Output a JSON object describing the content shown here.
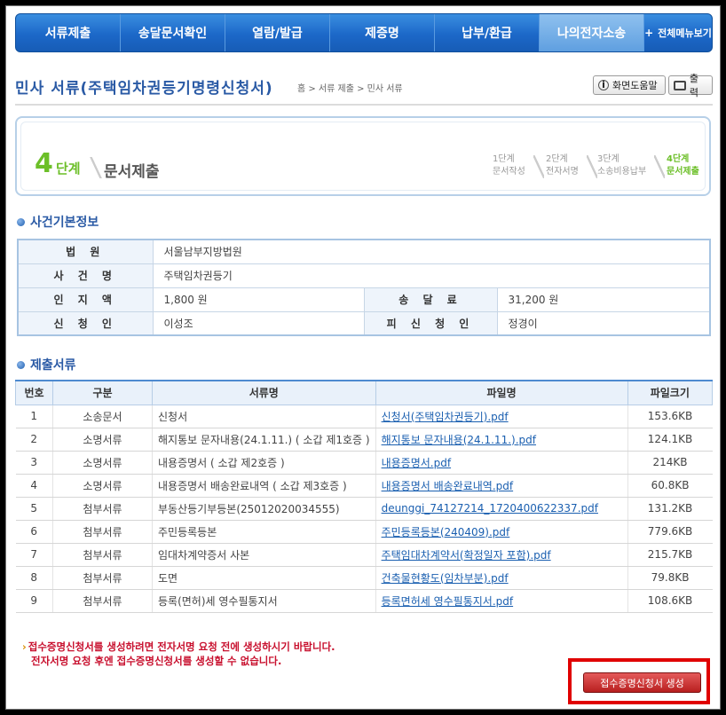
{
  "nav": {
    "items": [
      "서류제출",
      "송달문서확인",
      "열람/발급",
      "제증명",
      "납부/환급",
      "나의전자소송"
    ],
    "active_index": 5,
    "all_menu": "전체메뉴보기"
  },
  "header": {
    "title": "민사 서류(주택임차권등기명령신청서)",
    "breadcrumb": "홈 > 서류 제출 > 민사 서류",
    "help_label": "화면도움말",
    "print_label": "출력"
  },
  "step": {
    "number": "4",
    "unit": "단계",
    "title": "문서제출",
    "steps": [
      {
        "n": "1단계",
        "label": "문서작성",
        "current": false
      },
      {
        "n": "2단계",
        "label": "전자서명",
        "current": false
      },
      {
        "n": "3단계",
        "label": "소송비용납부",
        "current": false
      },
      {
        "n": "4단계",
        "label": "문서제출",
        "current": true
      }
    ]
  },
  "case_info": {
    "heading": "사건기본정보",
    "court_label": "법 원",
    "court": "서울남부지방법원",
    "case_name_label": "사 건 명",
    "case_name": "주택임차권등기",
    "stamp_label": "인 지 액",
    "stamp": "1,800 원",
    "delivery_label": "송 달 료",
    "delivery": "31,200 원",
    "applicant_label": "신 청 인",
    "applicant": "이성조",
    "respondent_label": "피 신 청 인",
    "respondent": "정경이"
  },
  "docs": {
    "heading": "제출서류",
    "columns": [
      "번호",
      "구분",
      "서류명",
      "파일명",
      "파일크기"
    ],
    "rows": [
      [
        "1",
        "소송문서",
        "신청서",
        "신청서(주택임차권등기).pdf",
        "153.6KB"
      ],
      [
        "2",
        "소명서류",
        "해지통보 문자내용(24.1.11.) ( 소갑 제1호증 )",
        "해지통보 문자내용(24.1.11.).pdf",
        "124.1KB"
      ],
      [
        "3",
        "소명서류",
        "내용증명서 ( 소갑 제2호증 )",
        "내용증명서.pdf",
        "214KB"
      ],
      [
        "4",
        "소명서류",
        "내용증명서 배송완료내역 ( 소갑 제3호증 )",
        "내용증명서 배송완료내역.pdf",
        "60.8KB"
      ],
      [
        "5",
        "첨부서류",
        "부동산등기부등본(25012020034555)",
        "deunggi_74127214_1720400622337.pdf",
        "131.2KB"
      ],
      [
        "6",
        "첨부서류",
        "주민등록등본",
        "주민등록등본(240409).pdf",
        "779.6KB"
      ],
      [
        "7",
        "첨부서류",
        "임대차계약증서 사본",
        "주택임대차계약서(확정일자 포함).pdf",
        "215.7KB"
      ],
      [
        "8",
        "첨부서류",
        "도면",
        "건축물현황도(임차부분).pdf",
        "79.8KB"
      ],
      [
        "9",
        "첨부서류",
        "등록(면허)세 영수필통지서",
        "등록면허세 영수필통지서.pdf",
        "108.6KB"
      ]
    ]
  },
  "notice": {
    "line1": "접수증명신청서를 생성하려면 전자서명 요청 전에 생성하시기 바랍니다.",
    "line2": "전자서명 요청 후엔 접수증명신청서를 생성할 수 없습니다."
  },
  "generate_button": "접수증명신청서 생성",
  "colors": {
    "nav": "#1c68c8",
    "accent_green": "#6cbf28",
    "title_blue": "#2a5aa5",
    "warning_red": "#c8102e"
  }
}
